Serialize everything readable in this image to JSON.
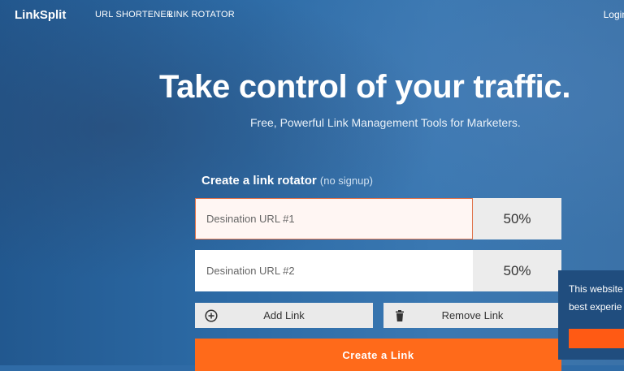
{
  "nav": {
    "brand": "LinkSplit",
    "links": [
      "URL SHORTENER",
      "LINK ROTATOR"
    ],
    "login": "Login"
  },
  "hero": {
    "headline": "Take control of your traffic.",
    "subheadline": "Free, Powerful Link Management Tools for Marketers."
  },
  "form": {
    "title": "Create a link rotator",
    "hint": "(no signup)",
    "rows": [
      {
        "placeholder": "Desination URL #1",
        "value": "",
        "percent": "50%"
      },
      {
        "placeholder": "Desination URL #2",
        "value": "",
        "percent": "50%"
      }
    ],
    "add_label": "Add Link",
    "remove_label": "Remove Link",
    "submit_label": "Create a Link"
  },
  "cookie": {
    "line1": "This website",
    "line2": "best experie"
  },
  "colors": {
    "accent": "#ff6a1a",
    "hero_blue": "#2f6ba6",
    "focus_border": "#e0734c"
  }
}
